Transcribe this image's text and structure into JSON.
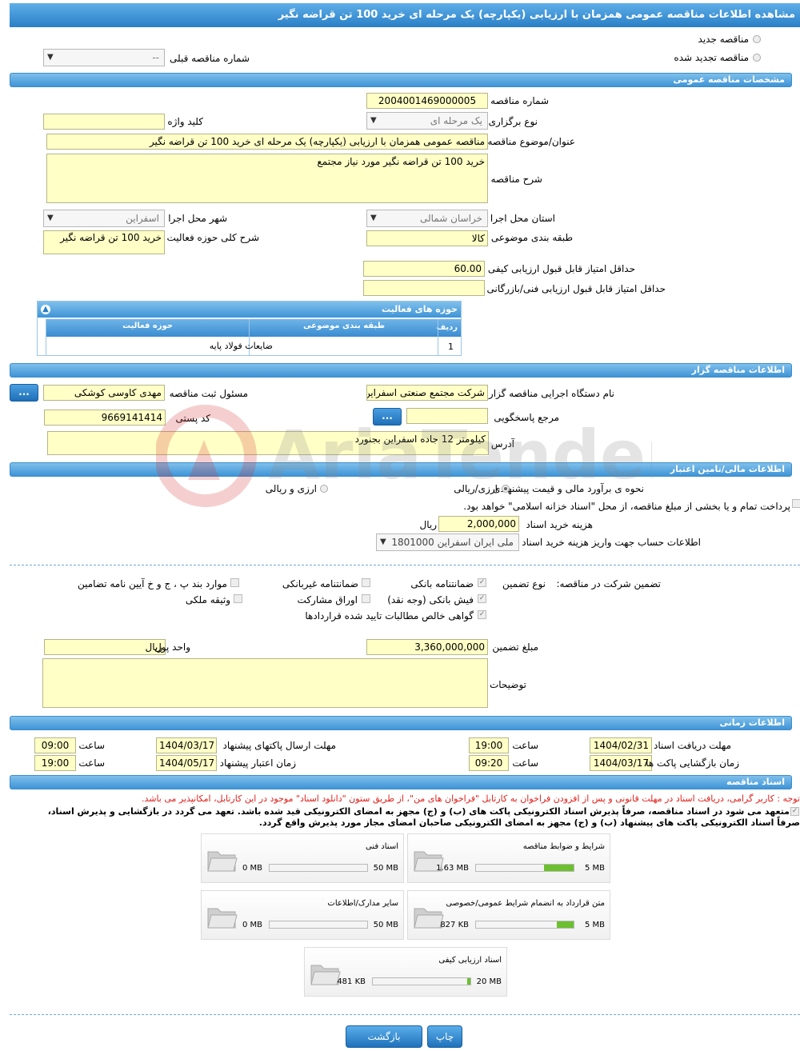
{
  "title": "مشاهده اطلاعات مناقصه عمومی همزمان با ارزیابی (یکپارچه) یک مرحله ای خرید 100 تن قراضه نگیر",
  "top": {
    "radio_new": "مناقصه جدید",
    "radio_renewed": "مناقصه تجدید شده",
    "prev_number_label": "شماره مناقصه قبلی",
    "prev_number_value": "--"
  },
  "general": {
    "header": "مشخصات مناقصه عمومی",
    "number_label": "شماره مناقصه",
    "number_value": "2004001469000005",
    "holding_type_label": "نوع برگزاری",
    "holding_type_value": "یک مرحله ای",
    "keyword_label": "کلید واژه",
    "keyword_value": "",
    "subject_label": "عنوان/موضوع مناقصه",
    "subject_value": "مناقصه عمومی همزمان با ارزیابی (یکپارچه) یک مرحله ای خرید 100 تن قراضه نگیر",
    "description_label": "شرح مناقصه",
    "description_value": "خرید 100 تن قراضه نگیر مورد نیاز مجتمع",
    "province_label": "استان محل اجرا",
    "province_value": "خراسان شمالی",
    "city_label": "شهر محل اجرا",
    "city_value": "اسفراین",
    "category_label": "طبقه بندی موضوعی",
    "category_value": "کالا",
    "activity_desc_label": "شرح کلی حوزه فعالیت",
    "activity_desc_value": "خرید 100 تن قراضه نگیر",
    "min_quality_label": "حداقل امتیاز قابل قبول ارزیابی کیفی",
    "min_quality_value": "60.00",
    "min_tech_label": "حداقل امتیاز قابل قبول ارزیابی فنی/بازرگانی",
    "min_tech_value": ""
  },
  "activities": {
    "header": "حوزه های فعالیت",
    "columns": [
      "ردیف",
      "طبقه بندی موضوعی",
      "حوزه فعالیت"
    ],
    "rows": [
      [
        "1",
        "",
        "ضایعات فولاد پایه"
      ]
    ]
  },
  "organizer": {
    "header": "اطلاعات مناقصه گزار",
    "org_label": "نام دستگاه اجرایی مناقصه گزار",
    "org_value": "شرکت مجتمع صنعتی اسفراین",
    "registrar_label": "مسئول ثبت مناقصه",
    "registrar_value": "مهدی کاوسی کوشکی",
    "ref_label": "مرجع پاسخگویی",
    "ref_value": "",
    "postal_label": "کد پستی",
    "postal_value": "9669141414",
    "address_label": "آدرس",
    "address_value": "کیلومتر 12 جاده اسفراین بجنورد",
    "more_btn": "..."
  },
  "finance": {
    "header": "اطلاعات مالی/تامین اعتبار",
    "estimate_label": "نحوه ی برآورد مالی و قیمت پیشنهادی",
    "opt_currency": "ارزی/ریالی",
    "opt_currency_rial": "ارزی و ریالی",
    "treasury_text": "پرداخت تمام و یا بخشی از مبلغ مناقصه، از محل \"اسناد خزانه اسلامی\" خواهد بود.",
    "doc_cost_label": "هزینه خرید اسناد",
    "doc_cost_value": "2,000,000",
    "doc_cost_unit": "ریال",
    "account_label": "اطلاعات حساب جهت واریز هزینه خرید اسناد",
    "account_value": "ملی ایران اسفراین 1801000"
  },
  "guarantee": {
    "section_label": "تضمین شرکت در مناقصه:",
    "type_label": "نوع تضمین",
    "options": {
      "bank_guarantee": "ضمانتنامه بانکی",
      "nonbank_guarantee": "ضمانتنامه غیربانکی",
      "other": "موارد بند پ ، ج و خ آیین نامه تضامین",
      "bank_receipt": "فیش بانکی (وجه نقد)",
      "bonds": "اوراق مشارکت",
      "property": "وثیقه ملکی",
      "receivables": "گواهی خالص مطالبات تایید شده قراردادها"
    },
    "amount_label": "مبلغ تضمین",
    "amount_value": "3,360,000,000",
    "currency_label": "واحد پول",
    "currency_value": "ریال",
    "notes_label": "توضیحات",
    "notes_value": ""
  },
  "timing": {
    "header": "اطلاعات زمانی",
    "doc_deadline_label": "مهلت دریافت اسناد",
    "doc_deadline_date": "1404/02/31",
    "doc_deadline_time": "19:00",
    "submit_deadline_label": "مهلت ارسال پاکتهای پیشنهاد",
    "submit_deadline_date": "1404/03/17",
    "submit_deadline_time": "09:00",
    "opening_label": "زمان بازگشایی پاکت ها",
    "opening_date": "1404/03/17",
    "opening_time": "09:20",
    "validity_label": "زمان اعتبار پیشنهاد",
    "validity_date": "1404/05/17",
    "validity_time": "19:00",
    "time_label": "ساعت"
  },
  "documents": {
    "header": "اسناد مناقصه",
    "notice": "توجه : کاربر گرامی، دریافت اسناد در مهلت قانونی و پس از افزودن فراخوان به کارتابل \"فراخوان های من\"، از طریق ستون \"دانلود اسناد\" موجود در این کارتابل، امکانپذیر می باشد.",
    "commit_line1": "متعهد می شود در اسناد مناقصه، صرفاً پذیرش اسناد الکترونیکی پاکت های (ب) و (ج) مجهز به امضای الکترونیکی قید شده باشد. تعهد می گردد در بازگشایی و پذیرش اسناد،",
    "commit_line2": "صرفاً اسناد الکترونیکی پاکت های پیشنهاد (ب) و (ج) مجهز به امضای الکترونیکی صاحبان امضای مجاز مورد پذیرش واقع گردد.",
    "files": [
      {
        "name": "شرایط و ضوابط مناقصه",
        "used": "1.63 MB",
        "max": "5 MB",
        "fill": 0.3
      },
      {
        "name": "اسناد فنی",
        "used": "0 MB",
        "max": "50 MB",
        "fill": 0.0
      },
      {
        "name": "متن قرارداد به انضمام شرایط عمومی/خصوصی",
        "used": "827 KB",
        "max": "5 MB",
        "fill": 0.17
      },
      {
        "name": "سایر مدارک/اطلاعات",
        "used": "0 MB",
        "max": "50 MB",
        "fill": 0.0
      },
      {
        "name": "اسناد ارزیابی کیفی",
        "used": "481 KB",
        "max": "20 MB",
        "fill": 0.03
      }
    ]
  },
  "buttons": {
    "print": "چاپ",
    "back": "بازگشت"
  },
  "colors": {
    "accent": "#3f94d6",
    "field_bg": "#ffffc6",
    "notice_red": "#e0201b",
    "progress": "#6cc02f"
  }
}
